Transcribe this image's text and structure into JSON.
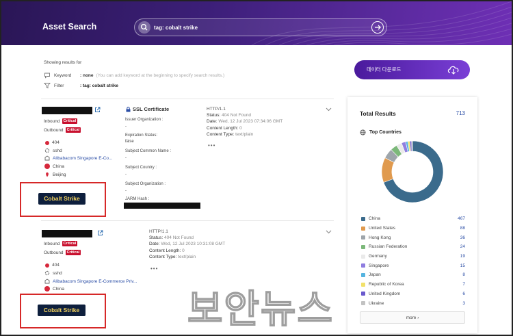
{
  "header": {
    "title": "Asset Search",
    "search_value": "tag: cobalt strike"
  },
  "results_info": {
    "showing": "Showing results for",
    "keyword_label": "Keyword",
    "keyword_value": ": none",
    "keyword_hint": "(You can add keyword at the beginning to specify search results.)",
    "filter_label": "Filter",
    "filter_value": ": tag: cobalt strike"
  },
  "download_button": "데이터 다운로드",
  "results": [
    {
      "inbound": "Inbound",
      "outbound": "Outbound",
      "inbound_badge": "Critical",
      "outbound_badge": "Critical",
      "status_code": "404",
      "service": "sshd",
      "org": "Alibabacom Singapore E-Co...",
      "country": "China",
      "city": "Beijing",
      "tag": "Cobalt Strike",
      "ssl": {
        "title": "SSL Certificate",
        "issuer_org_label": "Issuer Organization :",
        "issuer_org_value": "-",
        "expiration_label": "Expiration Status:",
        "expiration_value": "false",
        "subject_cn_label": "Subject Common Name :",
        "subject_cn_value": "-",
        "subject_country_label": "Subject Country :",
        "subject_country_value": "-",
        "subject_org_label": "Subject Organization :",
        "subject_org_value": "-",
        "jarm_label": "JARM Hash :"
      },
      "http": {
        "protocol": "HTTP/1.1",
        "status_label": "Status:",
        "status_value": "404 Not Found",
        "date_label": "Date:",
        "date_value": "Wed, 12 Jul 2023 07:34:06 GMT",
        "length_label": "Content Length:",
        "length_value": "0",
        "type_label": "Content Type:",
        "type_value": "text/plain"
      }
    },
    {
      "inbound": "Inbound",
      "outbound": "Outbound",
      "inbound_badge": "Critical",
      "outbound_badge": "Critical",
      "status_code": "404",
      "service": "sshd",
      "org": "Alibabacom Singapore E-Commerce Priv...",
      "country": "China",
      "tag": "Cobalt Strike",
      "http": {
        "protocol": "HTTP/1.1",
        "status_label": "Status:",
        "status_value": "404 Not Found",
        "date_label": "Date:",
        "date_value": "Wed, 12 Jul 2023 10:31:08 GMT",
        "length_label": "Content Length:",
        "length_value": "0",
        "type_label": "Content Type:",
        "type_value": "text/plain"
      }
    }
  ],
  "panel": {
    "total_label": "Total Results",
    "total_value": "713",
    "top_countries_label": "Top Countries",
    "more_label": "more ›"
  },
  "chart_data": {
    "type": "pie",
    "donut": true,
    "categories": [
      "China",
      "United States",
      "Hong Kong",
      "Russian Federation",
      "Germany",
      "Singapore",
      "Japan",
      "Republic of Korea",
      "United Kingdom",
      "Ukraine"
    ],
    "values": [
      467,
      88,
      36,
      24,
      19,
      15,
      8,
      7,
      6,
      3
    ],
    "colors": [
      "#3b6b8c",
      "#e09a4e",
      "#9ea5ab",
      "#7cb87a",
      "#eaeaea",
      "#8f7ee0",
      "#56b4e0",
      "#f2e16b",
      "#6a5acd",
      "#c2c2c2"
    ],
    "legend_position": "bottom"
  },
  "watermark": "보안뉴스"
}
